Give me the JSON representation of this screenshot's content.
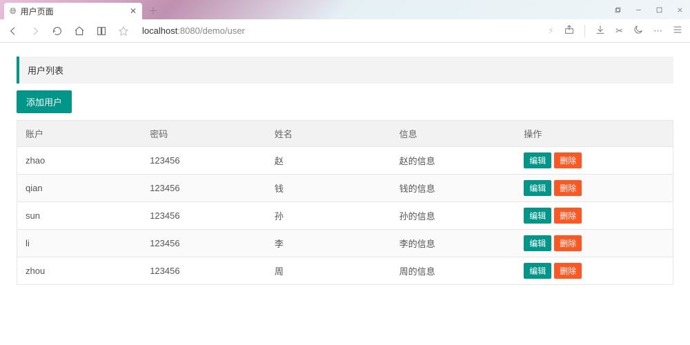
{
  "browser": {
    "tab_title": "用户页面",
    "url_host": "localhost",
    "url_port": ":8080",
    "url_path": "/demo/user"
  },
  "page": {
    "panel_title": "用户列表",
    "add_button": "添加用户"
  },
  "table": {
    "headers": {
      "account": "账户",
      "password": "密码",
      "name": "姓名",
      "info": "信息",
      "ops": "操作"
    },
    "action_labels": {
      "edit": "编辑",
      "delete": "删除"
    },
    "rows": [
      {
        "account": "zhao",
        "password": "123456",
        "name": "赵",
        "info": "赵的信息"
      },
      {
        "account": "qian",
        "password": "123456",
        "name": "钱",
        "info": "钱的信息"
      },
      {
        "account": "sun",
        "password": "123456",
        "name": "孙",
        "info": "孙的信息"
      },
      {
        "account": "li",
        "password": "123456",
        "name": "李",
        "info": "李的信息"
      },
      {
        "account": "zhou",
        "password": "123456",
        "name": "周",
        "info": "周的信息"
      }
    ]
  }
}
